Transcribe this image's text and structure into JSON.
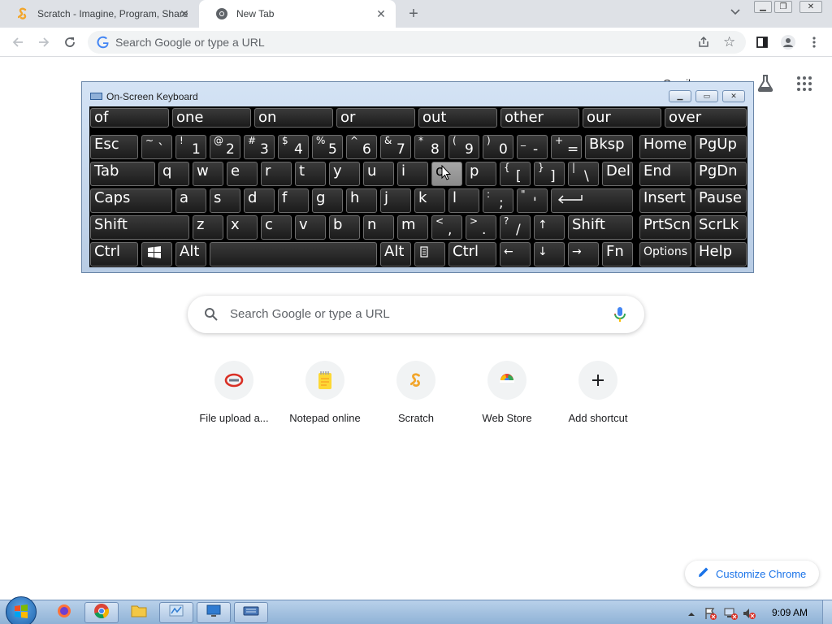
{
  "browser": {
    "tabs": [
      {
        "title": "Scratch - Imagine, Program, Share",
        "active": false,
        "favicon": "scratch-icon"
      },
      {
        "title": "New Tab",
        "active": true,
        "favicon": "chrome-icon"
      }
    ],
    "omnibox_placeholder": "Search Google or type a URL",
    "accent": "#1a73e8"
  },
  "ntp": {
    "gmail_label": "Gmail",
    "search_placeholder": "Search Google or type a URL",
    "shortcuts": [
      {
        "label": "File upload a...",
        "icon": "file-upload-icon"
      },
      {
        "label": "Notepad online",
        "icon": "notepad-icon"
      },
      {
        "label": "Scratch",
        "icon": "scratch-icon"
      },
      {
        "label": "Web Store",
        "icon": "web-store-icon"
      },
      {
        "label": "Add shortcut",
        "icon": "plus-icon"
      }
    ],
    "customize_label": "Customize Chrome"
  },
  "osk": {
    "title": "On-Screen Keyboard",
    "predictions": [
      "of",
      "one",
      "on",
      "or",
      "out",
      "other",
      "our",
      "over"
    ],
    "keys": {
      "esc": "Esc",
      "bksp": "Bksp",
      "home": "Home",
      "pgup": "PgUp",
      "tab": "Tab",
      "del": "Del",
      "end": "End",
      "pgdn": "PgDn",
      "caps": "Caps",
      "insert": "Insert",
      "pause": "Pause",
      "shift": "Shift",
      "prtscn": "PrtScn",
      "scrlk": "ScrLk",
      "ctrl": "Ctrl",
      "alt": "Alt",
      "fn": "Fn",
      "options": "Options",
      "help": "Help"
    },
    "row1": [
      [
        "~",
        "`"
      ],
      [
        "!",
        "1"
      ],
      [
        "@",
        "2"
      ],
      [
        "#",
        "3"
      ],
      [
        "$",
        "4"
      ],
      [
        "%",
        "5"
      ],
      [
        "^",
        "6"
      ],
      [
        "&",
        "7"
      ],
      [
        "*",
        "8"
      ],
      [
        "(",
        "9"
      ],
      [
        ")",
        "0"
      ],
      [
        "_",
        "-"
      ],
      [
        "+",
        "="
      ]
    ],
    "row2": [
      "q",
      "w",
      "e",
      "r",
      "t",
      "y",
      "u",
      "i",
      "o",
      "p"
    ],
    "row2_sym": [
      [
        "{",
        "["
      ],
      [
        "}",
        "]"
      ],
      [
        "|",
        "\\"
      ]
    ],
    "row3": [
      "a",
      "s",
      "d",
      "f",
      "g",
      "h",
      "j",
      "k",
      "l"
    ],
    "row3_sym": [
      [
        ":",
        ";"
      ],
      [
        "\"",
        "'"
      ]
    ],
    "row4": [
      "z",
      "x",
      "c",
      "v",
      "b",
      "n",
      "m"
    ],
    "row4_sym": [
      [
        "<",
        ","
      ],
      [
        ">",
        "."
      ],
      [
        "?",
        "/"
      ]
    ],
    "arrows": {
      "up": "↑",
      "left": "←",
      "down": "↓",
      "right": "→"
    }
  },
  "taskbar": {
    "time": "9:09 AM"
  }
}
